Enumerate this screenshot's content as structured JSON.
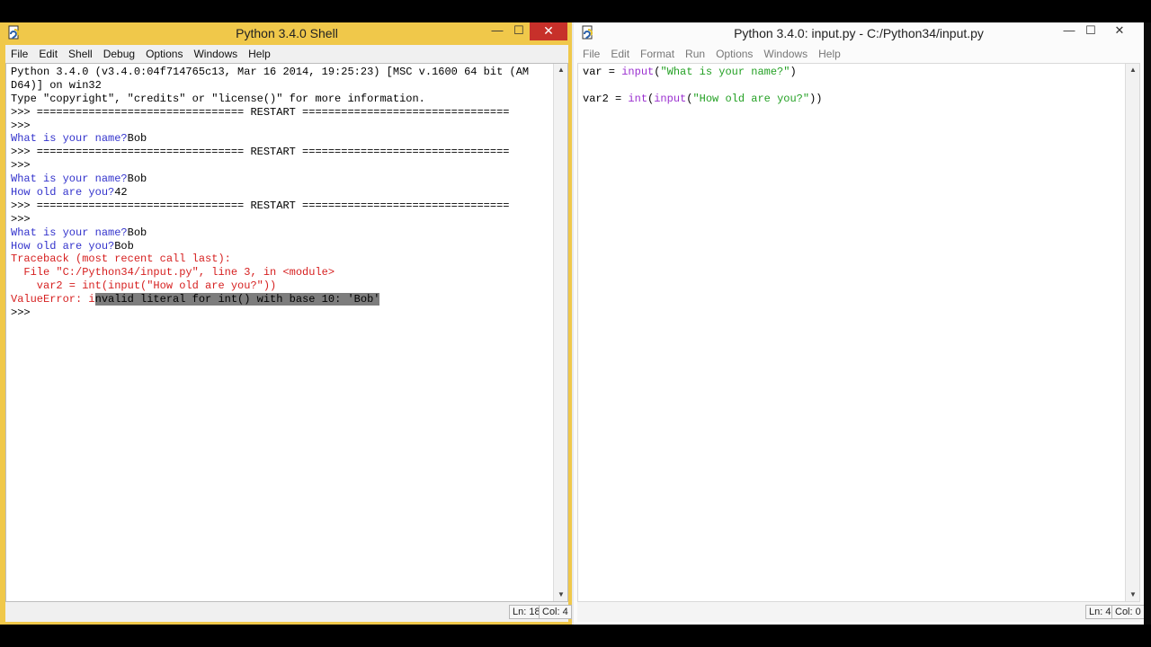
{
  "shell": {
    "title": "Python 3.4.0 Shell",
    "controls": {
      "minimize": "—",
      "maximize": "☐",
      "close": "✕"
    },
    "menu": [
      "File",
      "Edit",
      "Shell",
      "Debug",
      "Options",
      "Windows",
      "Help"
    ],
    "lines": [
      [
        {
          "t": "Python 3.4.0 (v3.4.0:04f714765c13, Mar 16 2014, 19:25:23) [MSC v.1600 64 bit (AM",
          "c": "black"
        }
      ],
      [
        {
          "t": "D64)] on win32",
          "c": "black"
        }
      ],
      [
        {
          "t": "Type \"copyright\", \"credits\" or \"license()\" for more information.",
          "c": "black"
        }
      ],
      [
        {
          "t": ">>> ================================ RESTART ================================",
          "c": "black"
        }
      ],
      [
        {
          "t": ">>>",
          "c": "black"
        }
      ],
      [
        {
          "t": "What is your name?",
          "c": "blue"
        },
        {
          "t": "Bob",
          "c": "black"
        }
      ],
      [
        {
          "t": ">>> ================================ RESTART ================================",
          "c": "black"
        }
      ],
      [
        {
          "t": ">>>",
          "c": "black"
        }
      ],
      [
        {
          "t": "What is your name?",
          "c": "blue"
        },
        {
          "t": "Bob",
          "c": "black"
        }
      ],
      [
        {
          "t": "How old are you?",
          "c": "blue"
        },
        {
          "t": "42",
          "c": "black"
        }
      ],
      [
        {
          "t": ">>> ================================ RESTART ================================",
          "c": "black"
        }
      ],
      [
        {
          "t": ">>>",
          "c": "black"
        }
      ],
      [
        {
          "t": "What is your name?",
          "c": "blue"
        },
        {
          "t": "Bob",
          "c": "black"
        }
      ],
      [
        {
          "t": "How old are you?",
          "c": "blue"
        },
        {
          "t": "Bob",
          "c": "black"
        }
      ],
      [
        {
          "t": "Traceback (most recent call last):",
          "c": "red"
        }
      ],
      [
        {
          "t": "  File \"C:/Python34/input.py\", line 3, in <module>",
          "c": "red"
        }
      ],
      [
        {
          "t": "    var2 = int(input(\"How old are you?\"))",
          "c": "red"
        }
      ],
      [
        {
          "t": "ValueError: i",
          "c": "red"
        },
        {
          "t": "nvalid literal for int() with base 10: 'Bob'",
          "c": "hl"
        }
      ],
      [
        {
          "t": ">>>",
          "c": "black"
        }
      ]
    ],
    "status": {
      "ln": "Ln: 18",
      "col": "Col: 4"
    }
  },
  "editor": {
    "title": "Python 3.4.0: input.py - C:/Python34/input.py",
    "controls": {
      "minimize": "—",
      "maximize": "☐",
      "close": "✕"
    },
    "menu": [
      "File",
      "Edit",
      "Format",
      "Run",
      "Options",
      "Windows",
      "Help"
    ],
    "lines": [
      [
        {
          "t": "var = ",
          "c": "black"
        },
        {
          "t": "input",
          "c": "purple"
        },
        {
          "t": "(",
          "c": "black"
        },
        {
          "t": "\"What is your name?\"",
          "c": "green"
        },
        {
          "t": ")",
          "c": "black"
        }
      ],
      [
        {
          "t": "",
          "c": "black"
        }
      ],
      [
        {
          "t": "var2 = ",
          "c": "black"
        },
        {
          "t": "int",
          "c": "purple"
        },
        {
          "t": "(",
          "c": "black"
        },
        {
          "t": "input",
          "c": "purple"
        },
        {
          "t": "(",
          "c": "black"
        },
        {
          "t": "\"How old are you?\"",
          "c": "green"
        },
        {
          "t": "))",
          "c": "black"
        }
      ]
    ],
    "status": {
      "ln": "Ln: 4",
      "col": "Col: 0"
    }
  },
  "icons": {
    "app": "python-idle-icon"
  }
}
